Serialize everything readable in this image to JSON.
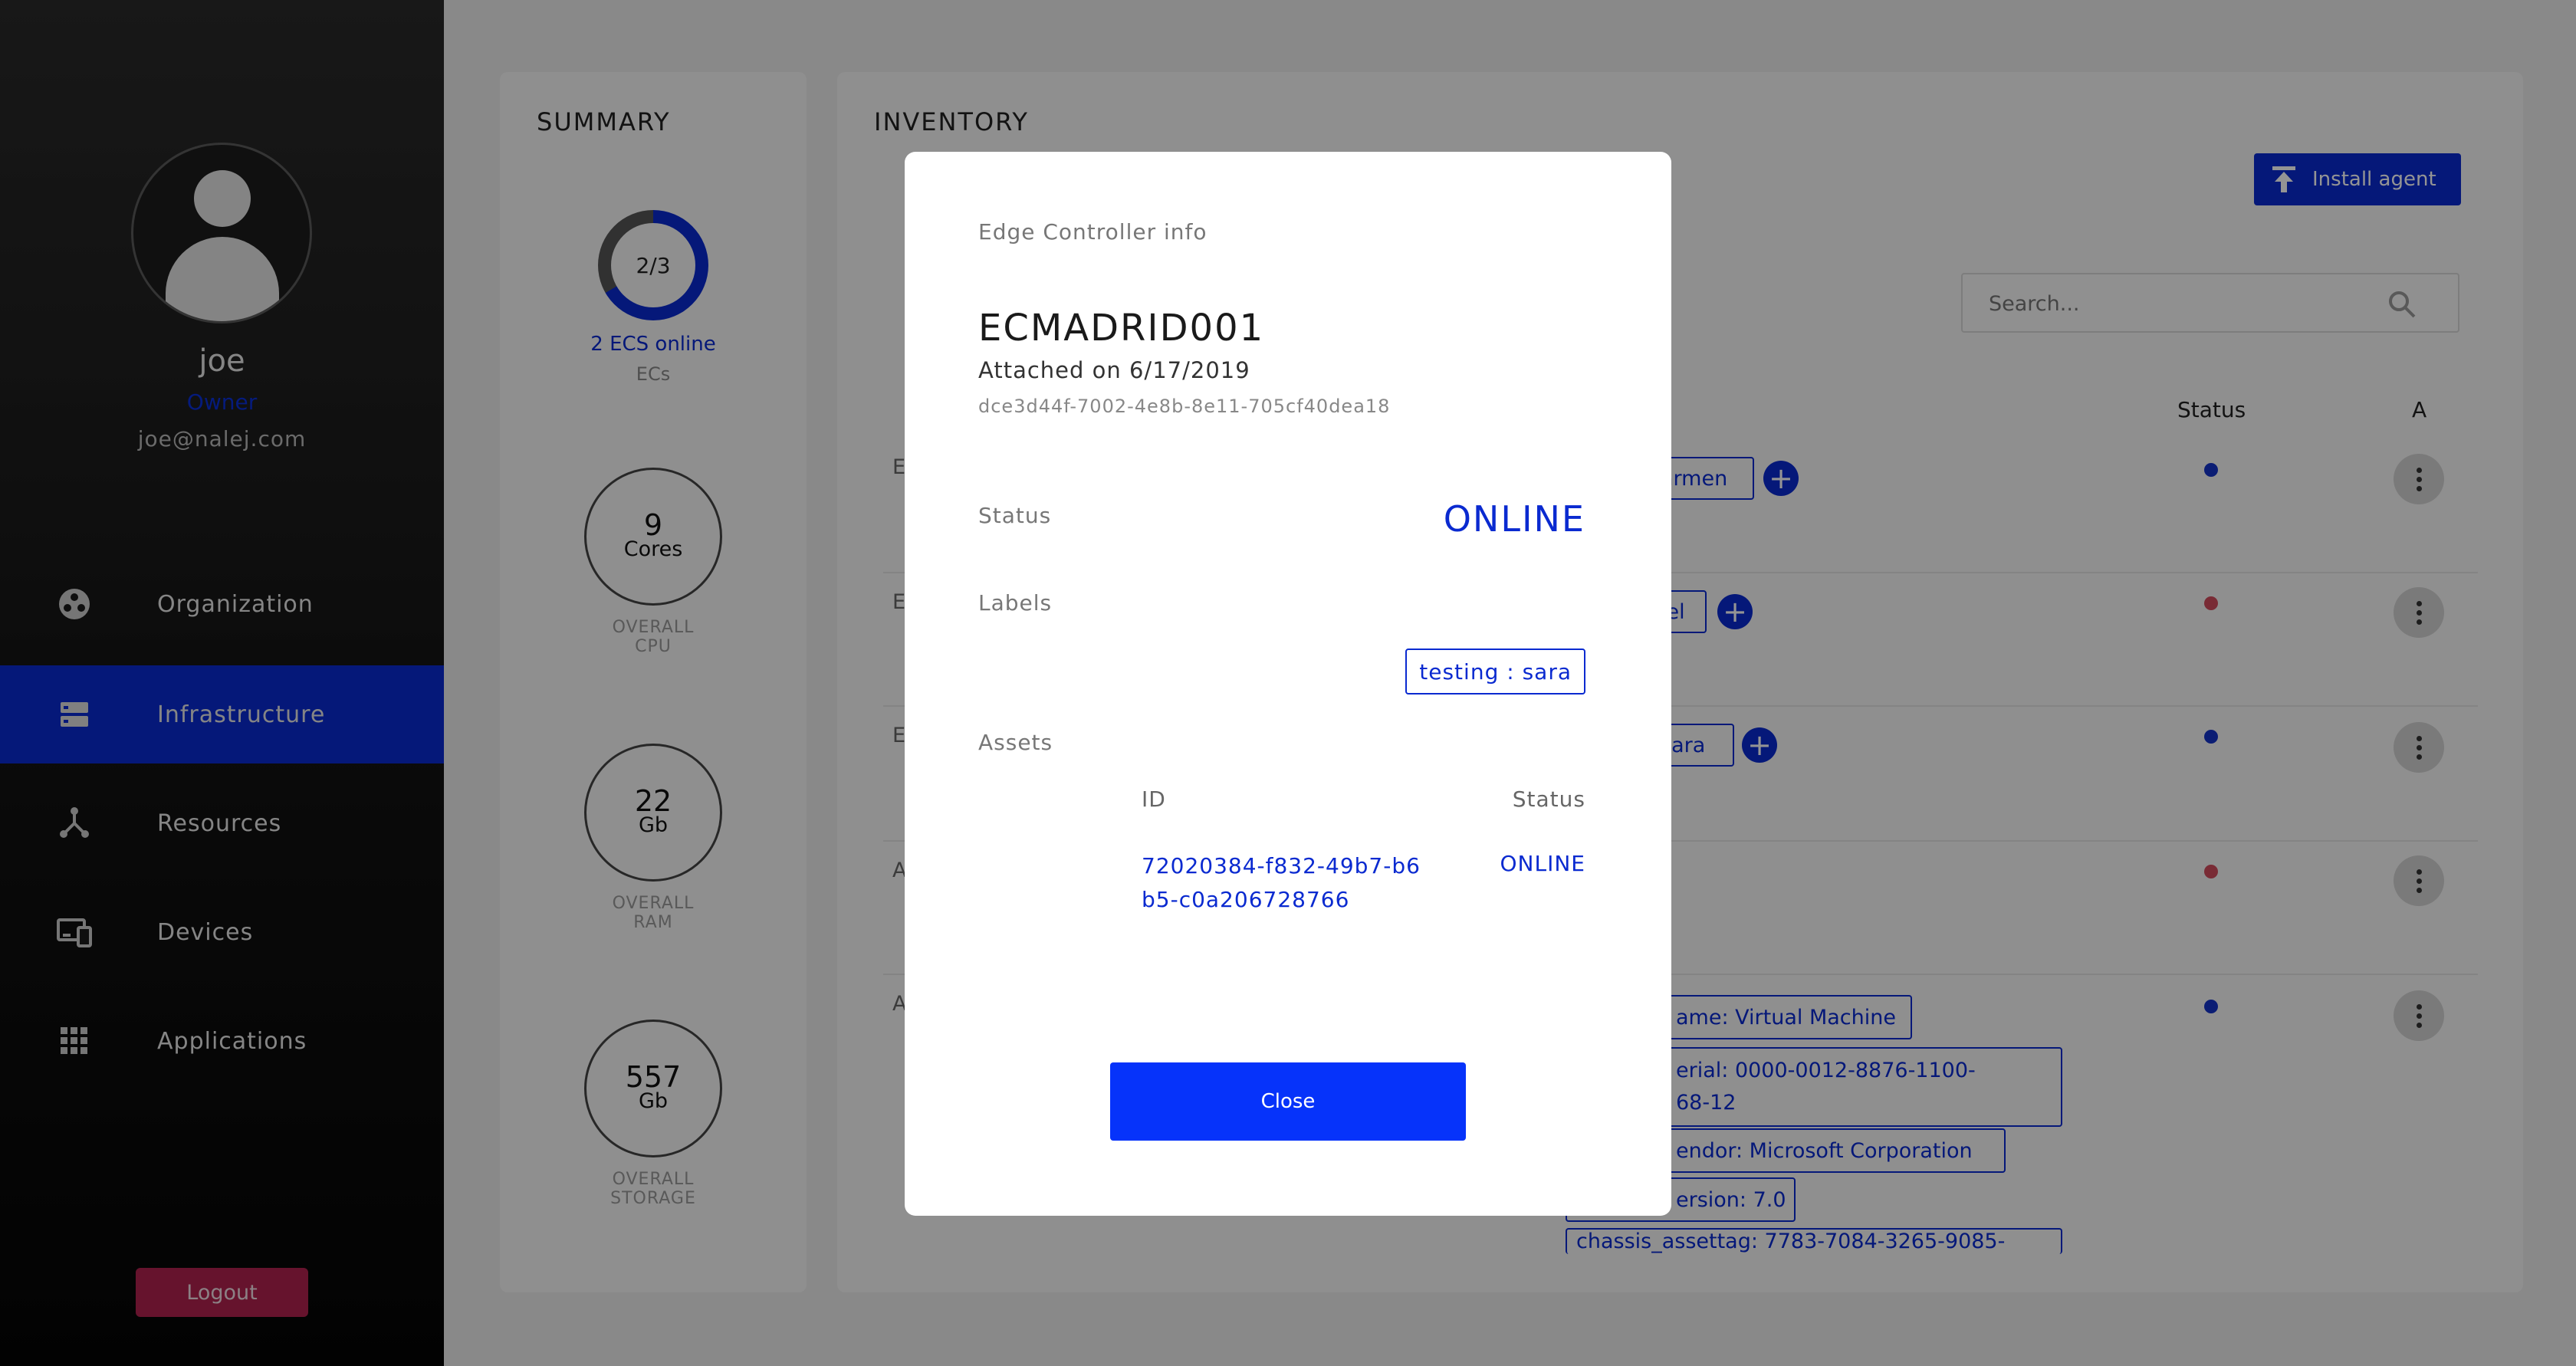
{
  "user": {
    "name": "joe",
    "role": "Owner",
    "email": "joe@nalej.com"
  },
  "nav": {
    "items": [
      {
        "label": "Organization",
        "icon": "organization-icon"
      },
      {
        "label": "Infrastructure",
        "icon": "infrastructure-icon",
        "active": true
      },
      {
        "label": "Resources",
        "icon": "resources-icon"
      },
      {
        "label": "Devices",
        "icon": "devices-icon"
      },
      {
        "label": "Applications",
        "icon": "applications-icon"
      }
    ],
    "logout_label": "Logout"
  },
  "summary": {
    "title": "SUMMARY",
    "ecs": {
      "ratio": "2/3",
      "online": 2,
      "total": 3,
      "online_label": "2 ECS online",
      "sub_label": "ECs"
    },
    "cpu": {
      "value": "9",
      "unit": "Cores",
      "caption_top": "OVERALL",
      "caption_bottom": "CPU"
    },
    "ram": {
      "value": "22",
      "unit": "Gb",
      "caption_top": "OVERALL",
      "caption_bottom": "RAM"
    },
    "storage": {
      "value": "557",
      "unit": "Gb",
      "caption_top": "OVERALL",
      "caption_bottom": "STORAGE"
    }
  },
  "inventory": {
    "title": "INVENTORY",
    "install_label": "Install agent",
    "search_placeholder": "Search...",
    "col_status": "Status",
    "col_actions": "A",
    "row_fragments": [
      "E",
      "E",
      "E",
      "A",
      "A"
    ],
    "visible_labels": {
      "row1": "armen",
      "row2": "iel",
      "row3": "sara",
      "row5": [
        "ame: Virtual Machine",
        "erial: 0000-0012-8876-1100-",
        "68-12",
        "endor: Microsoft Corporation",
        "ersion: 7.0",
        "chassis_assettag: 7783-7084-3265-9085-"
      ]
    },
    "status_colors": [
      "#1432c8",
      "#d04a5c",
      "#1432c8",
      "#d04a5c",
      "#1432c8"
    ]
  },
  "modal": {
    "header": "Edge Controller info",
    "name": "ECMADRID001",
    "attached": "Attached on 6/17/2019",
    "id": "dce3d44f-7002-4e8b-8e11-705cf40dea18",
    "status_label": "Status",
    "status_value": "ONLINE",
    "labels_label": "Labels",
    "label_chip": "testing : sara",
    "assets_label": "Assets",
    "assets_header_id": "ID",
    "assets_header_status": "Status",
    "assets": [
      {
        "id": "72020384-f832-49b7-b6b5-c0a206728766",
        "status": "ONLINE"
      }
    ],
    "close_label": "Close"
  }
}
